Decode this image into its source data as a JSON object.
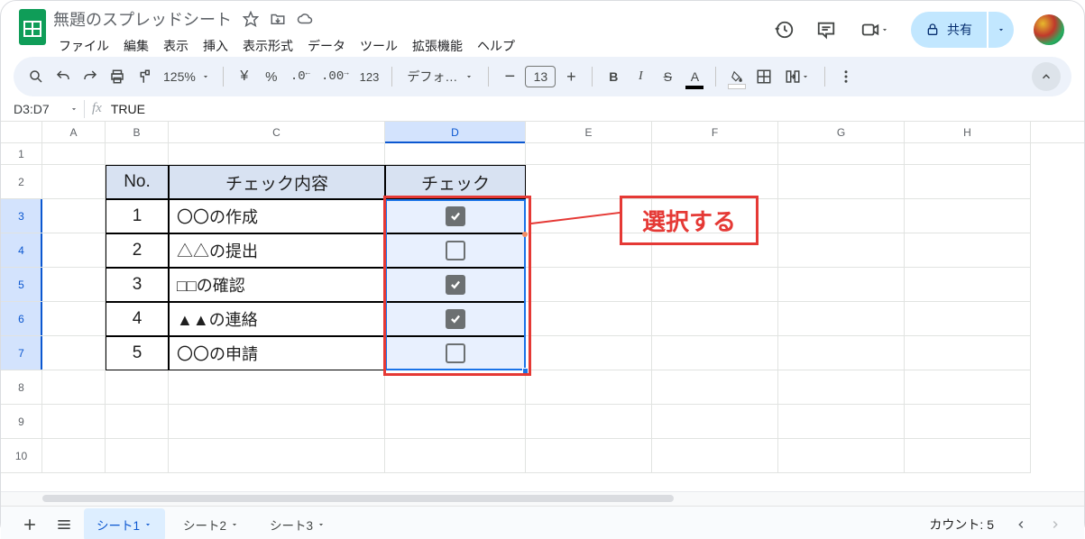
{
  "header": {
    "title": "無題のスプレッドシート",
    "menus": [
      "ファイル",
      "編集",
      "表示",
      "挿入",
      "表示形式",
      "データ",
      "ツール",
      "拡張機能",
      "ヘルプ"
    ],
    "share_label": "共有"
  },
  "toolbar": {
    "zoom": "125%",
    "font": "デフォ…",
    "font_size": "13"
  },
  "formula": {
    "name_box": "D3:D7",
    "value": "TRUE"
  },
  "columns": [
    "A",
    "B",
    "C",
    "D",
    "E",
    "F",
    "G",
    "H"
  ],
  "row_numbers": [
    "1",
    "2",
    "3",
    "4",
    "5",
    "6",
    "7",
    "8",
    "9",
    "10"
  ],
  "table": {
    "headers": {
      "no": "No.",
      "content": "チェック内容",
      "check": "チェック"
    },
    "rows": [
      {
        "no": "1",
        "content": "〇〇の作成",
        "checked": true
      },
      {
        "no": "2",
        "content": "△△の提出",
        "checked": false
      },
      {
        "no": "3",
        "content": "□□の確認",
        "checked": true
      },
      {
        "no": "4",
        "content": "▲▲の連絡",
        "checked": true
      },
      {
        "no": "5",
        "content": "〇〇の申請",
        "checked": false
      }
    ]
  },
  "annotation": {
    "label": "選択する"
  },
  "sheets": {
    "tabs": [
      {
        "label": "シート1",
        "active": true
      },
      {
        "label": "シート2",
        "active": false
      },
      {
        "label": "シート3",
        "active": false
      }
    ],
    "count_label": "カウント: 5"
  }
}
